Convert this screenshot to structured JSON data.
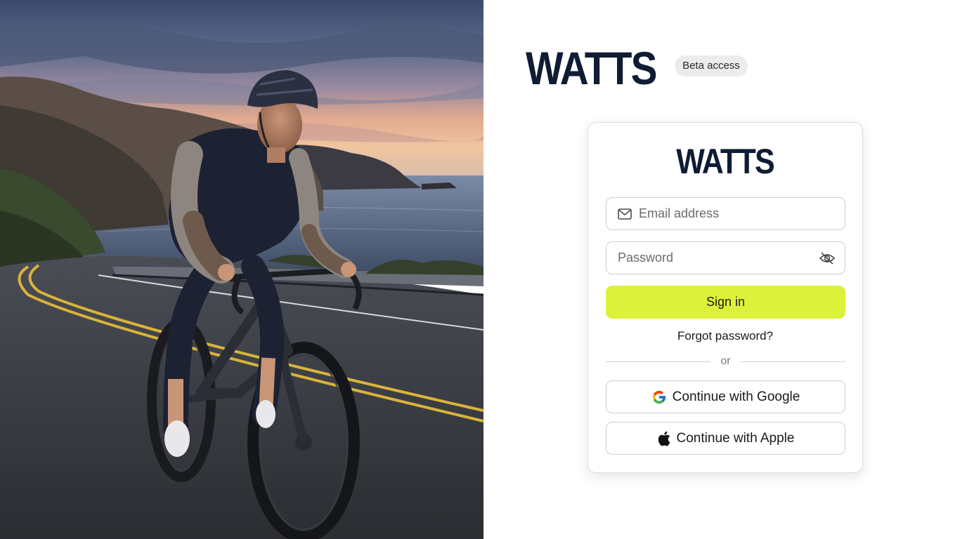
{
  "brand": {
    "name": "WATTS",
    "badge": "Beta access",
    "accent_color": "#dcf23a",
    "logo_color": "#0f1c33"
  },
  "hero": {
    "image": "cyclist-on-coastal-road-at-dusk"
  },
  "login_card": {
    "logo": "WATTS",
    "email": {
      "placeholder": "Email address",
      "icon": "mail-icon"
    },
    "password": {
      "placeholder": "Password",
      "icon": "eye-off-icon"
    },
    "signin_label": "Sign in",
    "forgot_label": "Forgot password?",
    "divider_label": "or",
    "google_label": "Continue with Google",
    "apple_label": "Continue with Apple"
  }
}
